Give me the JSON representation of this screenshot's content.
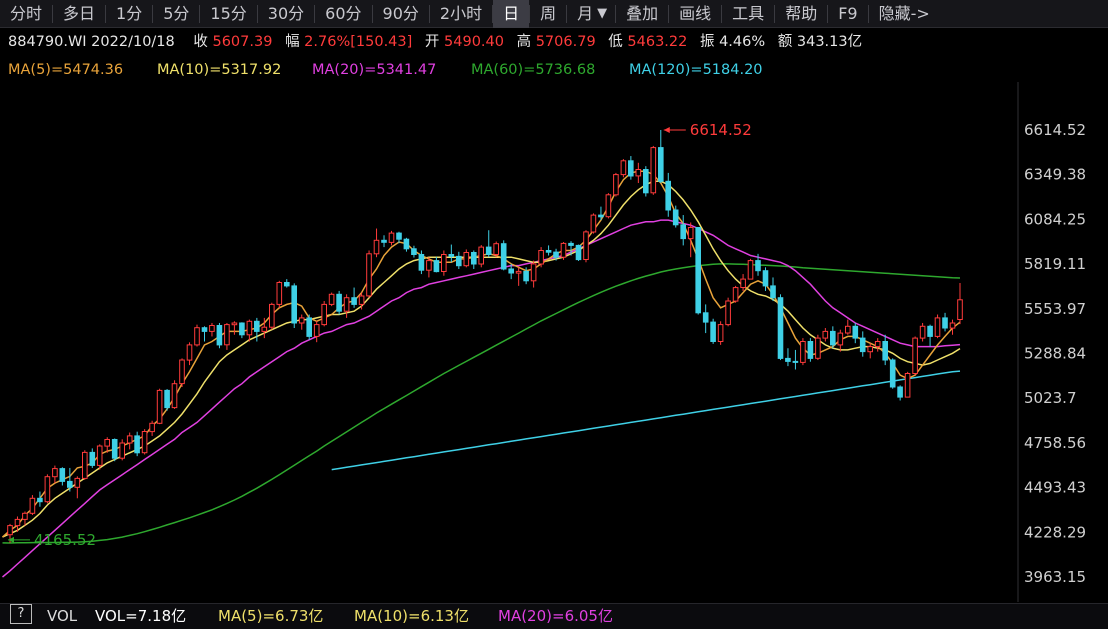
{
  "toolbar": {
    "items": [
      "分时",
      "多日",
      "1分",
      "5分",
      "15分",
      "30分",
      "60分",
      "90分",
      "2小时",
      "日",
      "周",
      "月"
    ],
    "active": "日",
    "right_items": [
      "叠加",
      "画线",
      "工具",
      "帮助",
      "F9",
      "隐藏->"
    ]
  },
  "info": {
    "code_date": "884790.WI 2022/10/18",
    "close_label": "收",
    "close_value": "5607.39",
    "range_label": "幅",
    "range_value": "2.76%[150.43]",
    "open_label": "开",
    "open_value": "5490.40",
    "high_label": "高",
    "high_value": "5706.79",
    "low_label": "低",
    "low_value": "5463.22",
    "amp_label": "振",
    "amp_value": "4.46%",
    "amount_label": "额",
    "amount_value": "343.13亿"
  },
  "ma_labels": [
    {
      "text": "MA(5)=5474.36",
      "color": "#e8a33a"
    },
    {
      "text": "MA(10)=5317.92",
      "color": "#efe06a"
    },
    {
      "text": "MA(20)=5341.47",
      "color": "#e040e0"
    },
    {
      "text": "MA(60)=5736.68",
      "color": "#2ea82e"
    },
    {
      "text": "MA(120)=5184.20",
      "color": "#3fd0e6"
    }
  ],
  "volume_bar": {
    "help": "?",
    "label": "VOL",
    "items": [
      {
        "text": "VOL=7.18亿",
        "color": "#ffffff"
      },
      {
        "text": "MA(5)=6.73亿",
        "color": "#efe06a"
      },
      {
        "text": "MA(10)=6.13亿",
        "color": "#efe06a"
      },
      {
        "text": "MA(20)=6.05亿",
        "color": "#e040e0"
      }
    ]
  },
  "chart_data": {
    "type": "candlestick",
    "y_ticks": [
      "6614.52",
      "6349.38",
      "6084.25",
      "5819.11",
      "5553.97",
      "5288.84",
      "5023.7",
      "4758.56",
      "4493.43",
      "4228.29",
      "3963.15"
    ],
    "ylim": [
      3963.15,
      6614.52
    ],
    "annotations": [
      {
        "text": "6614.52",
        "kind": "high",
        "value": 6614.52
      },
      {
        "text": "4165.52",
        "kind": "low",
        "value": 4165.52
      }
    ],
    "colors": {
      "up": "#ff3b3b",
      "down": "#3fd0e6"
    },
    "candles": [
      [
        4214,
        4278,
        4166,
        4268
      ],
      [
        4268,
        4322,
        4231,
        4305
      ],
      [
        4305,
        4352,
        4268,
        4341
      ],
      [
        4341,
        4449,
        4331,
        4430
      ],
      [
        4430,
        4470,
        4380,
        4410
      ],
      [
        4410,
        4572,
        4400,
        4558
      ],
      [
        4558,
        4624,
        4520,
        4606
      ],
      [
        4606,
        4614,
        4506,
        4530
      ],
      [
        4530,
        4610,
        4470,
        4495
      ],
      [
        4495,
        4560,
        4430,
        4548
      ],
      [
        4548,
        4715,
        4540,
        4702
      ],
      [
        4702,
        4726,
        4610,
        4625
      ],
      [
        4625,
        4750,
        4600,
        4740
      ],
      [
        4740,
        4792,
        4700,
        4779
      ],
      [
        4779,
        4785,
        4650,
        4668
      ],
      [
        4668,
        4780,
        4655,
        4758
      ],
      [
        4758,
        4820,
        4720,
        4800
      ],
      [
        4800,
        4825,
        4680,
        4700
      ],
      [
        4700,
        4840,
        4690,
        4826
      ],
      [
        4826,
        4890,
        4800,
        4875
      ],
      [
        4875,
        5080,
        4870,
        5070
      ],
      [
        5070,
        5078,
        4950,
        4968
      ],
      [
        4968,
        5130,
        4960,
        5110
      ],
      [
        5110,
        5260,
        5090,
        5250
      ],
      [
        5250,
        5355,
        5220,
        5340
      ],
      [
        5340,
        5460,
        5330,
        5442
      ],
      [
        5442,
        5450,
        5360,
        5420
      ],
      [
        5420,
        5470,
        5390,
        5455
      ],
      [
        5455,
        5470,
        5320,
        5340
      ],
      [
        5340,
        5470,
        5310,
        5460
      ],
      [
        5460,
        5480,
        5400,
        5470
      ],
      [
        5470,
        5474,
        5380,
        5400
      ],
      [
        5400,
        5490,
        5360,
        5480
      ],
      [
        5480,
        5500,
        5360,
        5420
      ],
      [
        5420,
        5500,
        5380,
        5445
      ],
      [
        5445,
        5590,
        5430,
        5580
      ],
      [
        5580,
        5720,
        5560,
        5710
      ],
      [
        5710,
        5730,
        5680,
        5690
      ],
      [
        5690,
        5705,
        5440,
        5470
      ],
      [
        5470,
        5520,
        5430,
        5500
      ],
      [
        5500,
        5520,
        5370,
        5390
      ],
      [
        5390,
        5482,
        5356,
        5460
      ],
      [
        5460,
        5600,
        5450,
        5580
      ],
      [
        5580,
        5650,
        5570,
        5640
      ],
      [
        5640,
        5660,
        5520,
        5540
      ],
      [
        5540,
        5640,
        5500,
        5620
      ],
      [
        5620,
        5680,
        5560,
        5580
      ],
      [
        5580,
        5650,
        5550,
        5630
      ],
      [
        5630,
        5900,
        5620,
        5880
      ],
      [
        5880,
        6030,
        5860,
        5960
      ],
      [
        5960,
        5990,
        5920,
        5948
      ],
      [
        5948,
        6016,
        5930,
        6003
      ],
      [
        6003,
        6011,
        5943,
        5967
      ],
      [
        5967,
        5975,
        5893,
        5910
      ],
      [
        5910,
        5928,
        5858,
        5876
      ],
      [
        5876,
        5900,
        5760,
        5783
      ],
      [
        5783,
        5860,
        5740,
        5840
      ],
      [
        5840,
        5862,
        5770,
        5775
      ],
      [
        5775,
        5900,
        5750,
        5876
      ],
      [
        5876,
        5935,
        5830,
        5865
      ],
      [
        5865,
        5892,
        5790,
        5810
      ],
      [
        5810,
        5906,
        5800,
        5888
      ],
      [
        5888,
        5900,
        5790,
        5820
      ],
      [
        5820,
        5932,
        5800,
        5920
      ],
      [
        5920,
        6020,
        5860,
        5876
      ],
      [
        5876,
        5953,
        5860,
        5940
      ],
      [
        5940,
        5960,
        5782,
        5790
      ],
      [
        5790,
        5820,
        5730,
        5766
      ],
      [
        5766,
        5800,
        5690,
        5776
      ],
      [
        5776,
        5800,
        5700,
        5720
      ],
      [
        5720,
        5840,
        5680,
        5820
      ],
      [
        5820,
        5920,
        5800,
        5900
      ],
      [
        5900,
        5930,
        5870,
        5890
      ],
      [
        5890,
        5910,
        5840,
        5860
      ],
      [
        5860,
        5950,
        5844,
        5942
      ],
      [
        5942,
        5955,
        5870,
        5930
      ],
      [
        5930,
        5935,
        5838,
        5846
      ],
      [
        5846,
        6020,
        5830,
        6010
      ],
      [
        6010,
        6120,
        6000,
        6110
      ],
      [
        6110,
        6160,
        6080,
        6100
      ],
      [
        6100,
        6240,
        6090,
        6230
      ],
      [
        6230,
        6360,
        6220,
        6350
      ],
      [
        6350,
        6442,
        6334,
        6432
      ],
      [
        6432,
        6460,
        6320,
        6342
      ],
      [
        6342,
        6420,
        6300,
        6380
      ],
      [
        6380,
        6400,
        6220,
        6242
      ],
      [
        6242,
        6520,
        6230,
        6510
      ],
      [
        6510,
        6614.52,
        6300,
        6310
      ],
      [
        6310,
        6360,
        6100,
        6140
      ],
      [
        6140,
        6166,
        6036,
        6052
      ],
      [
        6052,
        6110,
        5930,
        5970
      ],
      [
        5970,
        6066,
        5860,
        6036
      ],
      [
        6036,
        5980,
        5520,
        5530
      ],
      [
        5530,
        5580,
        5410,
        5475
      ],
      [
        5475,
        5495,
        5346,
        5360
      ],
      [
        5360,
        5480,
        5340,
        5460
      ],
      [
        5460,
        5620,
        5450,
        5600
      ],
      [
        5600,
        5690,
        5590,
        5680
      ],
      [
        5680,
        5760,
        5660,
        5730
      ],
      [
        5730,
        5850,
        5730,
        5840
      ],
      [
        5840,
        5880,
        5750,
        5780
      ],
      [
        5780,
        5800,
        5660,
        5690
      ],
      [
        5690,
        5740,
        5600,
        5620
      ],
      [
        5620,
        5640,
        5250,
        5260
      ],
      [
        5260,
        5320,
        5214,
        5242
      ],
      [
        5242,
        5310,
        5194,
        5236
      ],
      [
        5236,
        5380,
        5220,
        5360
      ],
      [
        5360,
        5380,
        5240,
        5260
      ],
      [
        5260,
        5400,
        5250,
        5380
      ],
      [
        5380,
        5440,
        5360,
        5420
      ],
      [
        5420,
        5450,
        5320,
        5340
      ],
      [
        5340,
        5430,
        5300,
        5410
      ],
      [
        5410,
        5490,
        5400,
        5450
      ],
      [
        5450,
        5470,
        5350,
        5380
      ],
      [
        5380,
        5420,
        5270,
        5300
      ],
      [
        5300,
        5350,
        5260,
        5330
      ],
      [
        5330,
        5380,
        5300,
        5360
      ],
      [
        5360,
        5400,
        5220,
        5250
      ],
      [
        5250,
        5260,
        5080,
        5090
      ],
      [
        5090,
        5100,
        5010,
        5030
      ],
      [
        5030,
        5180,
        5030,
        5170
      ],
      [
        5170,
        5390,
        5160,
        5380
      ],
      [
        5380,
        5470,
        5360,
        5450
      ],
      [
        5450,
        5460,
        5330,
        5390
      ],
      [
        5390,
        5520,
        5380,
        5500
      ],
      [
        5500,
        5530,
        5420,
        5440
      ],
      [
        5440,
        5490,
        5400,
        5470
      ],
      [
        5490.4,
        5706.79,
        5463.22,
        5607.39
      ]
    ],
    "ma5": [
      4200,
      4240,
      4270,
      4330,
      4370,
      4430,
      4490,
      4520,
      4540,
      4560,
      4610,
      4620,
      4640,
      4690,
      4710,
      4720,
      4740,
      4760,
      4780,
      4800,
      4860,
      4900,
      4960,
      5030,
      5110,
      5180,
      5260,
      5340,
      5360,
      5390,
      5420,
      5420,
      5420,
      5430,
      5440,
      5470,
      5520,
      5560,
      5580,
      5590,
      5570,
      5500,
      5480,
      5500,
      5520,
      5560,
      5590,
      5600,
      5650,
      5730,
      5790,
      5870,
      5920,
      5950,
      5940,
      5900,
      5870,
      5850,
      5830,
      5830,
      5830,
      5850,
      5850,
      5860,
      5870,
      5880,
      5870,
      5850,
      5820,
      5800,
      5780,
      5790,
      5820,
      5850,
      5880,
      5900,
      5900,
      5920,
      5960,
      6020,
      6080,
      6160,
      6250,
      6320,
      6360,
      6370,
      6370,
      6350,
      6300,
      6220,
      6120,
      6060,
      5960,
      5850,
      5730,
      5620,
      5560,
      5580,
      5600,
      5650,
      5700,
      5720,
      5700,
      5640,
      5560,
      5470,
      5380,
      5320,
      5280,
      5290,
      5310,
      5330,
      5370,
      5390,
      5390,
      5370,
      5350,
      5330,
      5290,
      5230,
      5160,
      5140,
      5160,
      5220,
      5280,
      5340,
      5390,
      5440,
      5474.36
    ],
    "ma10": [
      4200,
      4220,
      4240,
      4270,
      4300,
      4340,
      4390,
      4430,
      4460,
      4490,
      4520,
      4550,
      4580,
      4610,
      4640,
      4660,
      4680,
      4700,
      4720,
      4740,
      4770,
      4800,
      4840,
      4880,
      4930,
      4990,
      5050,
      5120,
      5180,
      5240,
      5280,
      5310,
      5340,
      5370,
      5390,
      5410,
      5430,
      5450,
      5470,
      5480,
      5490,
      5490,
      5500,
      5510,
      5520,
      5520,
      5530,
      5540,
      5570,
      5620,
      5670,
      5710,
      5750,
      5790,
      5820,
      5840,
      5850,
      5860,
      5860,
      5860,
      5860,
      5860,
      5860,
      5860,
      5860,
      5860,
      5860,
      5860,
      5860,
      5850,
      5840,
      5830,
      5830,
      5840,
      5850,
      5860,
      5880,
      5900,
      5930,
      5960,
      6000,
      6050,
      6110,
      6170,
      6220,
      6260,
      6290,
      6310,
      6310,
      6290,
      6250,
      6200,
      6140,
      6070,
      5990,
      5910,
      5840,
      5780,
      5730,
      5690,
      5660,
      5640,
      5630,
      5610,
      5580,
      5540,
      5490,
      5440,
      5400,
      5370,
      5340,
      5320,
      5310,
      5310,
      5320,
      5330,
      5330,
      5320,
      5310,
      5290,
      5260,
      5240,
      5230,
      5220,
      5230,
      5250,
      5270,
      5290,
      5317.92
    ],
    "ma20": [
      3963,
      4000,
      4040,
      4080,
      4120,
      4160,
      4200,
      4240,
      4280,
      4320,
      4360,
      4400,
      4440,
      4480,
      4510,
      4540,
      4570,
      4600,
      4630,
      4660,
      4690,
      4720,
      4750,
      4780,
      4820,
      4850,
      4880,
      4920,
      4960,
      5000,
      5040,
      5080,
      5110,
      5150,
      5180,
      5210,
      5240,
      5270,
      5300,
      5320,
      5350,
      5370,
      5390,
      5410,
      5420,
      5440,
      5460,
      5470,
      5490,
      5510,
      5540,
      5570,
      5600,
      5620,
      5650,
      5670,
      5680,
      5700,
      5710,
      5720,
      5730,
      5740,
      5750,
      5760,
      5770,
      5780,
      5790,
      5800,
      5810,
      5810,
      5820,
      5830,
      5840,
      5850,
      5860,
      5870,
      5890,
      5910,
      5930,
      5950,
      5970,
      5990,
      6010,
      6030,
      6050,
      6060,
      6070,
      6070,
      6080,
      6080,
      6070,
      6060,
      6050,
      6030,
      6010,
      5990,
      5960,
      5930,
      5910,
      5890,
      5870,
      5860,
      5850,
      5840,
      5830,
      5810,
      5780,
      5740,
      5700,
      5650,
      5600,
      5560,
      5530,
      5500,
      5470,
      5450,
      5430,
      5410,
      5390,
      5370,
      5350,
      5340,
      5330,
      5330,
      5330,
      5330,
      5335,
      5338,
      5341.47
    ],
    "ma60": [
      4165.52,
      4165,
      4166,
      4166,
      4167,
      4167,
      4168,
      4168,
      4169,
      4169,
      4170,
      4172,
      4175,
      4180,
      4185,
      4192,
      4200,
      4210,
      4220,
      4232,
      4245,
      4258,
      4272,
      4286,
      4300,
      4314,
      4330,
      4346,
      4362,
      4380,
      4400,
      4420,
      4442,
      4466,
      4490,
      4516,
      4542,
      4570,
      4598,
      4626,
      4654,
      4682,
      4710,
      4740,
      4768,
      4796,
      4824,
      4852,
      4880,
      4908,
      4936,
      4962,
      4988,
      5014,
      5040,
      5066,
      5092,
      5118,
      5144,
      5170,
      5194,
      5218,
      5242,
      5266,
      5290,
      5314,
      5338,
      5362,
      5386,
      5410,
      5434,
      5458,
      5482,
      5504,
      5526,
      5548,
      5570,
      5592,
      5612,
      5632,
      5652,
      5670,
      5688,
      5704,
      5720,
      5734,
      5748,
      5760,
      5772,
      5782,
      5790,
      5798,
      5804,
      5810,
      5814,
      5818,
      5820,
      5820,
      5819,
      5818,
      5816,
      5814,
      5812,
      5810,
      5808,
      5805,
      5802,
      5798,
      5795,
      5792,
      5789,
      5786,
      5783,
      5780,
      5777,
      5774,
      5771,
      5768,
      5765,
      5762,
      5759,
      5756,
      5753,
      5750,
      5747,
      5744,
      5741,
      5738,
      5736.68
    ],
    "ma120": [
      4600,
      4607,
      4614,
      4621,
      4628,
      4635,
      4642,
      4649,
      4656,
      4663,
      4670,
      4677,
      4684,
      4691,
      4698,
      4705,
      4712,
      4719,
      4726,
      4733,
      4740,
      4747,
      4754,
      4761,
      4768,
      4775,
      4782,
      4789,
      4796,
      4803,
      4810,
      4817,
      4824,
      4831,
      4838,
      4845,
      4852,
      4859,
      4866,
      4873,
      4880,
      4887,
      4894,
      4901,
      4908,
      4915,
      4922,
      4929,
      4936,
      4943,
      4950,
      4957,
      4964,
      4971,
      4978,
      4985,
      4992,
      4999,
      5006,
      5013,
      5020,
      5027,
      5034,
      5041,
      5048,
      5055,
      5062,
      5069,
      5076,
      5083,
      5090,
      5097,
      5104,
      5111,
      5118,
      5125,
      5132,
      5139,
      5146,
      5153,
      5160,
      5167,
      5174,
      5181,
      5184.2
    ]
  }
}
